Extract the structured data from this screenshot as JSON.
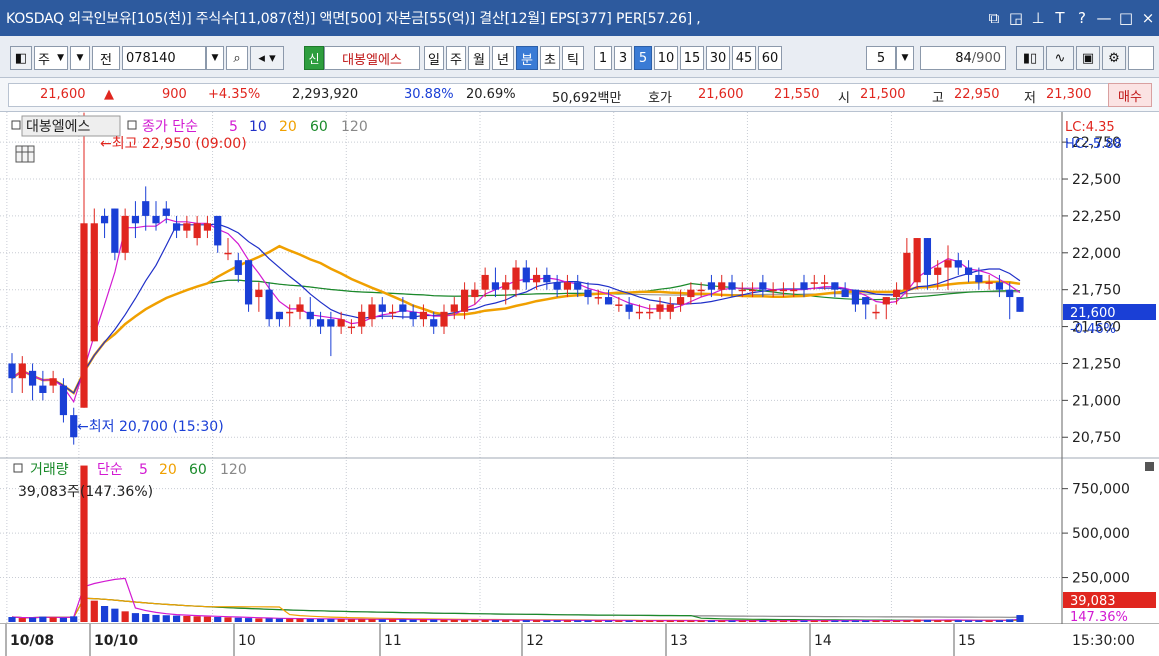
{
  "titlebar": {
    "text": "KOSDAQ 외국인보유[105(천)] 주식수[11,087(천)] 액면[500] 자본금[55(억)] 결산[12월] EPS[377] PER[57.26] ,",
    "icons": [
      "restore-icon",
      "popup-icon",
      "pin-icon",
      "font-icon",
      "help-icon"
    ],
    "win": {
      "minimize": "—",
      "maximize": "□",
      "close": "×"
    }
  },
  "toolbar": {
    "market": "주",
    "mode": "전",
    "code": "078140",
    "badge": "신",
    "name": "대봉엘에스",
    "periods": [
      "일",
      "주",
      "월",
      "년",
      "분",
      "초",
      "틱"
    ],
    "active_period": "분",
    "intervals": [
      "1",
      "3",
      "5",
      "10",
      "15",
      "30",
      "45",
      "60"
    ],
    "active_interval": "5",
    "interval_select": "5",
    "count": "84",
    "count_total": "/900"
  },
  "quote": {
    "price": "21,600",
    "arrow": "▲",
    "change": "900",
    "change_pct": "+4.35%",
    "volume": "2,293,920",
    "ratio1": "30.88%",
    "ratio2": "20.69%",
    "amount": "50,692백만",
    "hoga_label": "호가",
    "ask": "21,600",
    "bid": "21,550",
    "open_label": "시",
    "open": "21,500",
    "high_label": "고",
    "high": "22,950",
    "low_label": "저",
    "low": "21,300",
    "buy_label": "매수"
  },
  "price_panel": {
    "stock_label": "대봉엘에스",
    "legend_title": "종가 단순",
    "ma_periods": [
      "5",
      "10",
      "20",
      "60",
      "120"
    ],
    "ma_colors": [
      "#d21ad2",
      "#2030c8",
      "#f0a000",
      "#1a8a2a",
      "#888888"
    ],
    "max_label": "최고 22,950 (09:00)",
    "min_label": "최저 20,700 (15:30)",
    "lc": "LC:4.35",
    "hc": "HC:-5.88",
    "y_ticks": [
      "22,750",
      "22,500",
      "22,250",
      "22,000",
      "21,750",
      "21,500",
      "21,250",
      "21,000",
      "20,750"
    ],
    "last_price": "21,600",
    "last_pct": "-0.46%"
  },
  "volume_panel": {
    "legend_title": "거래량",
    "legend_sma": "단순",
    "ma_periods": [
      "5",
      "20",
      "60",
      "120"
    ],
    "ma_colors": [
      "#d21ad2",
      "#f0a000",
      "#1a8a2a",
      "#888888"
    ],
    "current": "39,083주(147.36%)",
    "y_ticks": [
      "750,000",
      "500,000",
      "250,000"
    ],
    "last_volume": "39,083",
    "last_pct": "147.36%"
  },
  "x_axis": {
    "labels": [
      "10/08",
      "10/10",
      "10",
      "11",
      "12",
      "13",
      "14",
      "15"
    ],
    "time": "15:30:00"
  },
  "colors": {
    "up": "#e0261f",
    "down": "#1a3fd6",
    "accent": "#2d5a9e"
  },
  "chart_data": {
    "type": "candlestick",
    "ylim": [
      20650,
      22900
    ],
    "volume_ylim": [
      0,
      900000
    ],
    "candles": [
      {
        "o": 21250,
        "h": 21320,
        "l": 21050,
        "c": 21150
      },
      {
        "o": 21150,
        "h": 21300,
        "l": 21050,
        "c": 21250
      },
      {
        "o": 21200,
        "h": 21250,
        "l": 21000,
        "c": 21100
      },
      {
        "o": 21100,
        "h": 21200,
        "l": 21000,
        "c": 21050
      },
      {
        "o": 21100,
        "h": 21200,
        "l": 21050,
        "c": 21150
      },
      {
        "o": 21100,
        "h": 21150,
        "l": 20850,
        "c": 20900
      },
      {
        "o": 20900,
        "h": 20950,
        "l": 20700,
        "c": 20750
      },
      {
        "o": 20950,
        "h": 22950,
        "l": 20950,
        "c": 22200
      },
      {
        "o": 21400,
        "h": 22300,
        "l": 21400,
        "c": 22200
      },
      {
        "o": 22250,
        "h": 22300,
        "l": 22100,
        "c": 22200
      },
      {
        "o": 22300,
        "h": 22300,
        "l": 21950,
        "c": 22000
      },
      {
        "o": 22000,
        "h": 22300,
        "l": 21950,
        "c": 22250
      },
      {
        "o": 22250,
        "h": 22350,
        "l": 22100,
        "c": 22200
      },
      {
        "o": 22350,
        "h": 22450,
        "l": 22150,
        "c": 22250
      },
      {
        "o": 22250,
        "h": 22350,
        "l": 22150,
        "c": 22200
      },
      {
        "o": 22300,
        "h": 22350,
        "l": 22200,
        "c": 22250
      },
      {
        "o": 22200,
        "h": 22250,
        "l": 22100,
        "c": 22150
      },
      {
        "o": 22150,
        "h": 22250,
        "l": 22100,
        "c": 22200
      },
      {
        "o": 22100,
        "h": 22250,
        "l": 22050,
        "c": 22200
      },
      {
        "o": 22150,
        "h": 22250,
        "l": 22100,
        "c": 22200
      },
      {
        "o": 22250,
        "h": 22250,
        "l": 22000,
        "c": 22050
      },
      {
        "o": 22000,
        "h": 22100,
        "l": 21950,
        "c": 22000
      },
      {
        "o": 21950,
        "h": 22000,
        "l": 21800,
        "c": 21850
      },
      {
        "o": 21950,
        "h": 21950,
        "l": 21600,
        "c": 21650
      },
      {
        "o": 21700,
        "h": 21800,
        "l": 21600,
        "c": 21750
      },
      {
        "o": 21750,
        "h": 21800,
        "l": 21500,
        "c": 21550
      },
      {
        "o": 21600,
        "h": 21600,
        "l": 21500,
        "c": 21550
      },
      {
        "o": 21600,
        "h": 21650,
        "l": 21500,
        "c": 21600
      },
      {
        "o": 21600,
        "h": 21700,
        "l": 21550,
        "c": 21650
      },
      {
        "o": 21600,
        "h": 21700,
        "l": 21500,
        "c": 21550
      },
      {
        "o": 21550,
        "h": 21600,
        "l": 21450,
        "c": 21500
      },
      {
        "o": 21550,
        "h": 21600,
        "l": 21300,
        "c": 21500
      },
      {
        "o": 21500,
        "h": 21600,
        "l": 21450,
        "c": 21550
      },
      {
        "o": 21500,
        "h": 21550,
        "l": 21450,
        "c": 21500
      },
      {
        "o": 21500,
        "h": 21650,
        "l": 21450,
        "c": 21600
      },
      {
        "o": 21550,
        "h": 21700,
        "l": 21500,
        "c": 21650
      },
      {
        "o": 21650,
        "h": 21700,
        "l": 21550,
        "c": 21600
      },
      {
        "o": 21600,
        "h": 21650,
        "l": 21550,
        "c": 21600
      },
      {
        "o": 21650,
        "h": 21700,
        "l": 21550,
        "c": 21600
      },
      {
        "o": 21600,
        "h": 21650,
        "l": 21500,
        "c": 21550
      },
      {
        "o": 21550,
        "h": 21650,
        "l": 21500,
        "c": 21600
      },
      {
        "o": 21550,
        "h": 21600,
        "l": 21450,
        "c": 21500
      },
      {
        "o": 21500,
        "h": 21650,
        "l": 21450,
        "c": 21600
      },
      {
        "o": 21600,
        "h": 21700,
        "l": 21550,
        "c": 21650
      },
      {
        "o": 21600,
        "h": 21800,
        "l": 21550,
        "c": 21750
      },
      {
        "o": 21700,
        "h": 21800,
        "l": 21650,
        "c": 21750
      },
      {
        "o": 21750,
        "h": 21900,
        "l": 21700,
        "c": 21850
      },
      {
        "o": 21800,
        "h": 21900,
        "l": 21700,
        "c": 21750
      },
      {
        "o": 21750,
        "h": 21850,
        "l": 21650,
        "c": 21800
      },
      {
        "o": 21750,
        "h": 21950,
        "l": 21700,
        "c": 21900
      },
      {
        "o": 21900,
        "h": 21950,
        "l": 21750,
        "c": 21800
      },
      {
        "o": 21800,
        "h": 21900,
        "l": 21750,
        "c": 21850
      },
      {
        "o": 21850,
        "h": 21900,
        "l": 21750,
        "c": 21800
      },
      {
        "o": 21800,
        "h": 21850,
        "l": 21700,
        "c": 21750
      },
      {
        "o": 21750,
        "h": 21850,
        "l": 21700,
        "c": 21800
      },
      {
        "o": 21800,
        "h": 21850,
        "l": 21700,
        "c": 21750
      },
      {
        "o": 21750,
        "h": 21800,
        "l": 21650,
        "c": 21700
      },
      {
        "o": 21700,
        "h": 21750,
        "l": 21650,
        "c": 21700
      },
      {
        "o": 21700,
        "h": 21750,
        "l": 21650,
        "c": 21650
      },
      {
        "o": 21650,
        "h": 21700,
        "l": 21600,
        "c": 21650
      },
      {
        "o": 21650,
        "h": 21700,
        "l": 21550,
        "c": 21600
      },
      {
        "o": 21600,
        "h": 21650,
        "l": 21550,
        "c": 21600
      },
      {
        "o": 21600,
        "h": 21650,
        "l": 21550,
        "c": 21600
      },
      {
        "o": 21600,
        "h": 21700,
        "l": 21550,
        "c": 21650
      },
      {
        "o": 21600,
        "h": 21700,
        "l": 21550,
        "c": 21650
      },
      {
        "o": 21650,
        "h": 21750,
        "l": 21600,
        "c": 21700
      },
      {
        "o": 21700,
        "h": 21800,
        "l": 21650,
        "c": 21750
      },
      {
        "o": 21750,
        "h": 21800,
        "l": 21700,
        "c": 21750
      },
      {
        "o": 21800,
        "h": 21850,
        "l": 21700,
        "c": 21750
      },
      {
        "o": 21750,
        "h": 21850,
        "l": 21700,
        "c": 21800
      },
      {
        "o": 21800,
        "h": 21850,
        "l": 21700,
        "c": 21750
      },
      {
        "o": 21750,
        "h": 21800,
        "l": 21700,
        "c": 21750
      },
      {
        "o": 21750,
        "h": 21800,
        "l": 21700,
        "c": 21750
      },
      {
        "o": 21800,
        "h": 21850,
        "l": 21700,
        "c": 21750
      },
      {
        "o": 21750,
        "h": 21800,
        "l": 21700,
        "c": 21750
      },
      {
        "o": 21750,
        "h": 21800,
        "l": 21700,
        "c": 21750
      },
      {
        "o": 21750,
        "h": 21800,
        "l": 21700,
        "c": 21750
      },
      {
        "o": 21800,
        "h": 21850,
        "l": 21700,
        "c": 21750
      },
      {
        "o": 21800,
        "h": 21850,
        "l": 21750,
        "c": 21800
      },
      {
        "o": 21800,
        "h": 21850,
        "l": 21750,
        "c": 21800
      },
      {
        "o": 21800,
        "h": 21800,
        "l": 21700,
        "c": 21750
      },
      {
        "o": 21750,
        "h": 21800,
        "l": 21700,
        "c": 21700
      },
      {
        "o": 21750,
        "h": 21750,
        "l": 21600,
        "c": 21650
      },
      {
        "o": 21700,
        "h": 21700,
        "l": 21550,
        "c": 21650
      },
      {
        "o": 21600,
        "h": 21650,
        "l": 21550,
        "c": 21600
      },
      {
        "o": 21650,
        "h": 21700,
        "l": 21550,
        "c": 21700
      },
      {
        "o": 21700,
        "h": 21800,
        "l": 21650,
        "c": 21750
      },
      {
        "o": 21750,
        "h": 22100,
        "l": 21700,
        "c": 22000
      },
      {
        "o": 21800,
        "h": 22100,
        "l": 21750,
        "c": 22100
      },
      {
        "o": 22100,
        "h": 22100,
        "l": 21750,
        "c": 21850
      },
      {
        "o": 21850,
        "h": 21950,
        "l": 21750,
        "c": 21900
      },
      {
        "o": 21900,
        "h": 22050,
        "l": 21750,
        "c": 21950
      },
      {
        "o": 21950,
        "h": 22000,
        "l": 21850,
        "c": 21900
      },
      {
        "o": 21900,
        "h": 21950,
        "l": 21800,
        "c": 21850
      },
      {
        "o": 21850,
        "h": 21900,
        "l": 21750,
        "c": 21800
      },
      {
        "o": 21800,
        "h": 21850,
        "l": 21750,
        "c": 21800
      },
      {
        "o": 21800,
        "h": 21850,
        "l": 21700,
        "c": 21750
      },
      {
        "o": 21750,
        "h": 21800,
        "l": 21550,
        "c": 21700
      },
      {
        "o": 21700,
        "h": 21700,
        "l": 21600,
        "c": 21600
      }
    ],
    "volumes": [
      28000,
      22000,
      25000,
      30000,
      26000,
      24000,
      32000,
      880000,
      120000,
      90000,
      75000,
      60000,
      50000,
      45000,
      40000,
      38000,
      36000,
      34000,
      32000,
      30000,
      28000,
      26000,
      24000,
      22000,
      20000,
      20000,
      19000,
      18000,
      18000,
      17000,
      17000,
      16000,
      16000,
      15000,
      15000,
      15000,
      14000,
      14000,
      14000,
      13000,
      13000,
      13000,
      12000,
      12000,
      12000,
      11000,
      11000,
      11000,
      10000,
      10000,
      10000,
      10000,
      9000,
      9000,
      9000,
      9000,
      9000,
      8000,
      8000,
      8000,
      8000,
      8000,
      8000,
      8000,
      8000,
      8000,
      8000,
      8000,
      8000,
      8000,
      8000,
      8000,
      8000,
      8000,
      8000,
      8000,
      8000,
      8000,
      8000,
      8000,
      8000,
      8000,
      8000,
      8000,
      8000,
      8000,
      8000,
      9000,
      14000,
      12000,
      10000,
      10000,
      10000,
      9000,
      9000,
      9000,
      10000,
      15000,
      39083
    ]
  }
}
